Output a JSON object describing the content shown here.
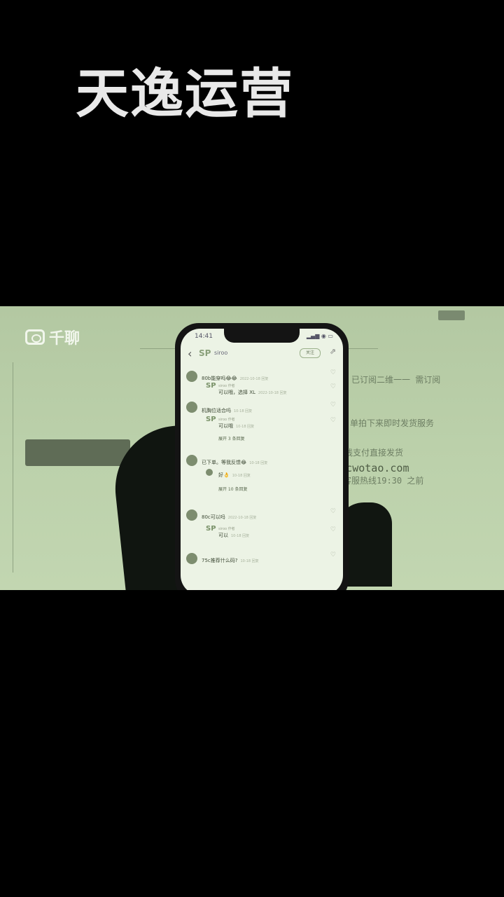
{
  "banner": {
    "title": "天逸运营"
  },
  "video": {
    "brand": "千聊",
    "bg_button": "",
    "bg_lines": [
      "已订阅二维一一 需订阅",
      "单拍下来即时发货服务",
      "在线支付直接发货",
      "www.nocwotao.com",
      "客服热线19:30 之前"
    ]
  },
  "phone": {
    "status_time": "14:41",
    "status_icons": "▂▄▆ ◉ ▭",
    "nav": {
      "back": "‹",
      "avatar": "SP",
      "name": "siroo",
      "follow": "关注",
      "share": "⇗"
    },
    "comments": [
      {
        "type": "sub-user",
        "user": "",
        "text": "80b能穿吗😂😂",
        "meta": "2022-10-18 回复"
      },
      {
        "type": "reply",
        "user": "siroo 作者",
        "text": "可以哦，选择 XL",
        "meta": "2022-10-18 回复"
      },
      {
        "type": "user",
        "user": "",
        "text": "机胸位适合吗",
        "meta": "10-18 回复"
      },
      {
        "type": "reply",
        "user": "siroo 作者",
        "text": "可以哦",
        "meta": "10-18 回复"
      },
      {
        "type": "expand",
        "text": "展开 3 条回复"
      },
      {
        "type": "user",
        "user": "",
        "text": "已下单。等我反馈😂",
        "meta": "10-18 回复"
      },
      {
        "type": "reply",
        "user": "",
        "text": "好👌",
        "meta": "10-18 回复"
      },
      {
        "type": "expand",
        "text": "展开 10 条回复"
      },
      {
        "type": "user",
        "user": "",
        "text": "80c可以吗",
        "meta": "2022-10-18 回复"
      },
      {
        "type": "reply",
        "user": "siroo 作者",
        "text": "可以",
        "meta": "10-18 回复"
      },
      {
        "type": "user",
        "user": "",
        "text": "75c推荐什么码?",
        "meta": "10-18 回复"
      }
    ]
  }
}
